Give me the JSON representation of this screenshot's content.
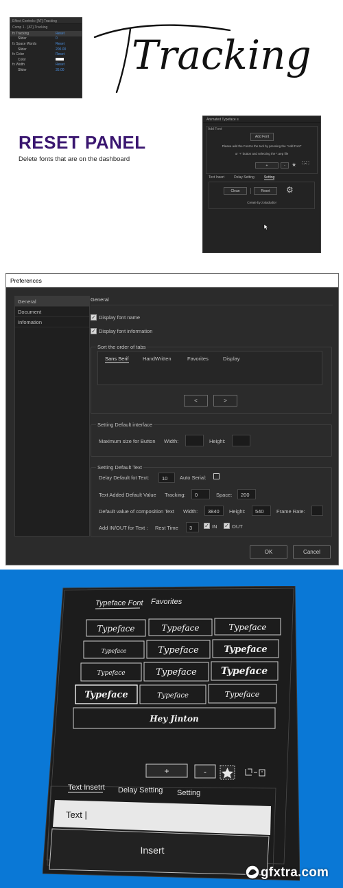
{
  "effect_controls": {
    "title": "Effect Controls: [AT]-Tracking",
    "comp_label": "Comp 1 · [AT]-Tracking",
    "rows": [
      {
        "name": "fx  Tracking",
        "value": "Reset"
      },
      {
        "name": "Slider",
        "value": "0"
      },
      {
        "name": "fx  Space Words",
        "value": "Reset"
      },
      {
        "name": "Slider",
        "value": "200.00"
      },
      {
        "name": "fx  Color",
        "value": "Reset"
      },
      {
        "name": "Color",
        "value": ""
      },
      {
        "name": "fx  Width",
        "value": "Reset"
      },
      {
        "name": "Slider",
        "value": "35.00"
      }
    ]
  },
  "hero_script": "Tracking",
  "reset_panel": {
    "heading": "RESET PANEL",
    "subheading": "Delete fonts that are on the dashboard",
    "panel_title": "Animated Typeface",
    "add_font_section": "Add Font",
    "add_font_button": "Add Font",
    "instructions_1": "Please add the Font to the tool by pressing the \"Add Font\"",
    "instructions_2": "or '+' button and selecting the *.aep file",
    "plus": "+",
    "minus": "-",
    "tabs": [
      "Text Insert",
      "Delay Setting",
      "Setting"
    ],
    "clean_button": "Clean",
    "reset_button": "Reset",
    "credit": "Create by zotiadudio!"
  },
  "preferences": {
    "window_title": "Preferences",
    "nav": [
      "General",
      "Document",
      "Infomation"
    ],
    "section_title": "General",
    "display_font_name": "Display font name",
    "display_font_info": "Display font information",
    "sort_group_label": "Sort the order of tabs",
    "sort_tabs": [
      "Sans Serif",
      "HandWritten",
      "Favorites",
      "Display"
    ],
    "prev": "<",
    "next": ">",
    "interface_group_label": "Setting Default interface",
    "max_size_label": "Maximum size for Button",
    "width_label": "Width:",
    "height_label": "Height:",
    "text_group_label": "Setting Default Text",
    "delay_label": "Delay Default fot Text:",
    "delay_value": "10",
    "auto_serial_label": "Auto Serial:",
    "added_value_label": "Text Added Default Value",
    "tracking_label": "Tracking:",
    "tracking_value": "0",
    "space_label": "Space:",
    "space_value": "200",
    "comp_label": "Default value of composition Text",
    "comp_width_label": "Width:",
    "comp_width_value": "3840",
    "comp_height_label": "Height:",
    "comp_height_value": "540",
    "frame_rate_label": "Frame Rate:",
    "inout_label": "Add IN/OUT for Text :",
    "rest_time_label": "Rest Time",
    "rest_time_value": "3",
    "in_label": "IN",
    "out_label": "OUT",
    "ok": "OK",
    "cancel": "Cancel"
  },
  "typeface_panel": {
    "tabs": [
      "Typeface Font",
      "Favorites"
    ],
    "tiles": [
      "Typeface",
      "Typeface",
      "Typeface",
      "Typeface",
      "Typeface",
      "Typeface",
      "Typeface",
      "Typeface",
      "Typeface",
      "Typeface",
      "Typeface",
      "Typeface",
      "Hey Jinton"
    ],
    "plus": "+",
    "minus": "-",
    "bottom_tabs": [
      "Text Insetrt",
      "Delay Setting",
      "Setting"
    ],
    "text_value": "Text |",
    "insert_button": "Insert"
  },
  "watermark": "gfxtra.com",
  "colors": {
    "reset_heading": "#3a1670",
    "promo_background": "#0a78d6",
    "panel_dark": "#232323",
    "link_blue": "#4a8fe0"
  }
}
